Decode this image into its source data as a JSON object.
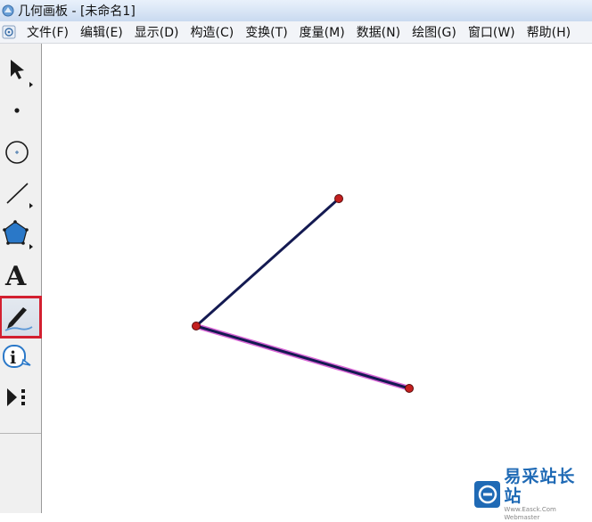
{
  "window": {
    "title": "几何画板 - [未命名1]"
  },
  "menu": {
    "items": [
      {
        "label": "文件(F)"
      },
      {
        "label": "编辑(E)"
      },
      {
        "label": "显示(D)"
      },
      {
        "label": "构造(C)"
      },
      {
        "label": "变换(T)"
      },
      {
        "label": "度量(M)"
      },
      {
        "label": "数据(N)"
      },
      {
        "label": "绘图(G)"
      },
      {
        "label": "窗口(W)"
      },
      {
        "label": "帮助(H)"
      }
    ]
  },
  "toolbox": {
    "tools": [
      {
        "icon": "arrow-select-icon"
      },
      {
        "icon": "point-tool-icon"
      },
      {
        "icon": "compass-tool-icon"
      },
      {
        "icon": "line-tool-icon"
      },
      {
        "icon": "polygon-tool-icon"
      },
      {
        "icon": "text-tool-icon",
        "glyph": "A"
      },
      {
        "icon": "marker-pen-icon",
        "selected": true
      },
      {
        "icon": "info-tool-icon",
        "glyph": "i"
      },
      {
        "icon": "custom-tool-icon"
      }
    ]
  },
  "colors": {
    "segment": "#141a52",
    "segment_highlight": "#d966d6",
    "point": "#c41f1f",
    "selection_outline": "#d32030",
    "brand": "#1f6ab5"
  },
  "watermark": {
    "brand_name": "易采站长站",
    "url": "Www.Easck.Com Webmaster"
  }
}
